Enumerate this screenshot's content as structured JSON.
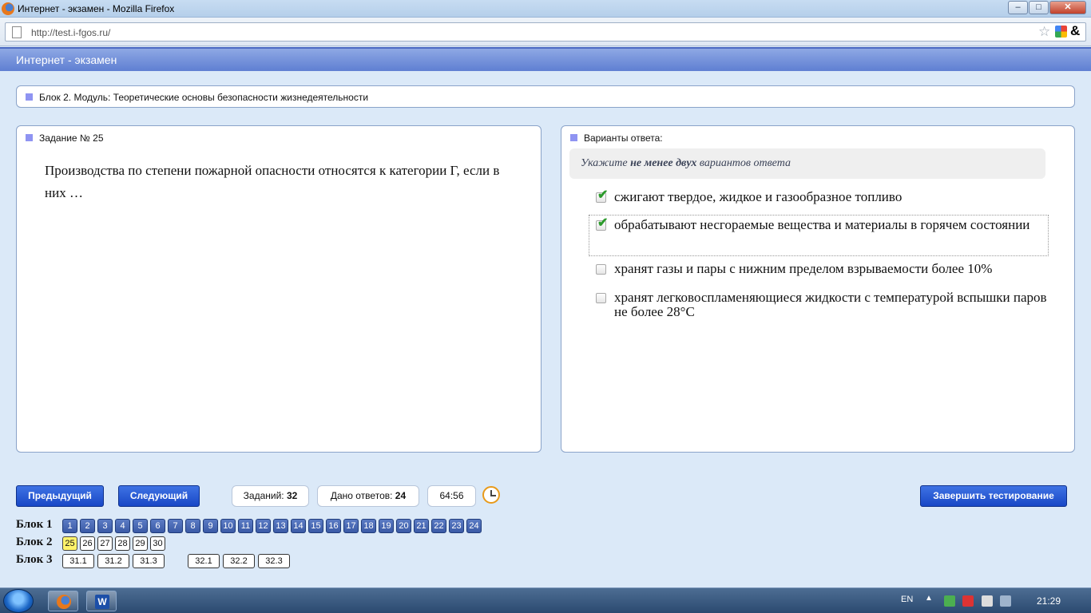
{
  "window": {
    "title": "Интернет - экзамен - Mozilla Firefox",
    "min": "‒",
    "max": "□",
    "close": "✕"
  },
  "browser": {
    "url": "http://test.i-fgos.ru/"
  },
  "app": {
    "title": "Интернет - экзамен"
  },
  "block_panel": {
    "label": "Блок 2. Модуль: Теоретические основы безопасности жизнедеятельности"
  },
  "task": {
    "label": "Задание № 25",
    "question": "Производства по степени пожарной опасности относятся к категории Г, если в них …"
  },
  "answers": {
    "label": "Варианты ответа:",
    "hint_prefix": "Укажите",
    "hint_bold": "не менее двух",
    "hint_suffix": "вариантов ответа",
    "options": [
      {
        "text": "сжигают твердое, жидкое и газообразное топливо",
        "checked": true
      },
      {
        "text": "обрабатывают несгораемые вещества и материалы в горячем состоянии",
        "checked": true
      },
      {
        "text": "хранят газы и пары с нижним пределом взрываемости более 10%",
        "checked": false
      },
      {
        "text": "хранят легковоспламеняющиеся жидкости с температурой вспышки паров не более 28°С",
        "checked": false
      }
    ]
  },
  "controls": {
    "prev": "Предыдущий",
    "next": "Следующий",
    "finish": "Завершить тестирование",
    "tasks_label": "Заданий:",
    "tasks_value": "32",
    "answers_label": "Дано ответов:",
    "answers_value": "24",
    "timer": "64:56"
  },
  "blocks": [
    {
      "label": "Блок 1",
      "items": [
        "1",
        "2",
        "3",
        "4",
        "5",
        "6",
        "7",
        "8",
        "9",
        "10",
        "11",
        "12",
        "13",
        "14",
        "15",
        "16",
        "17",
        "18",
        "19",
        "20",
        "21",
        "22",
        "23",
        "24"
      ],
      "state": "done"
    },
    {
      "label": "Блок 2",
      "items": [
        "25",
        "26",
        "27",
        "28",
        "29",
        "30"
      ],
      "state": "open",
      "current": "25"
    },
    {
      "label": "Блок 3",
      "items": [
        "31.1",
        "31.2",
        "31.3",
        "32.1",
        "32.2",
        "32.3"
      ],
      "state": "open"
    }
  ],
  "taskbar": {
    "lang": "EN",
    "clock": "21:29",
    "word_letter": "W"
  },
  "colors": {
    "accent": "#1847c6",
    "header": "#5f7fd2",
    "current_question": "#fff36b",
    "check": "#2c9a2c"
  }
}
